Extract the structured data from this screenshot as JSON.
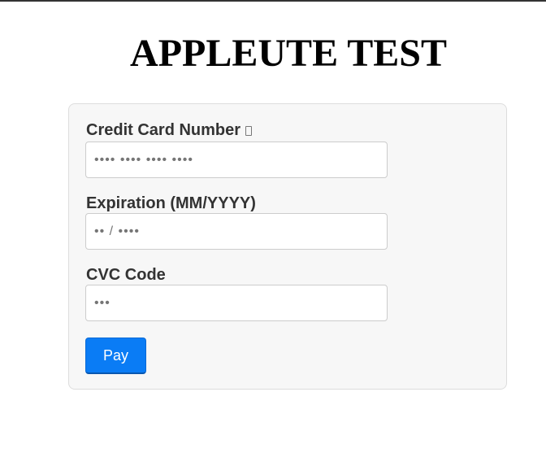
{
  "page": {
    "title": "APPLEUTE TEST"
  },
  "form": {
    "card_number": {
      "label": "Credit Card Number",
      "placeholder": "•••• •••• •••• ••••",
      "value": "",
      "icon": "card-icon"
    },
    "expiration": {
      "label": "Expiration (MM/YYYY)",
      "placeholder": "•• / ••••",
      "value": ""
    },
    "cvc": {
      "label": "CVC Code",
      "placeholder": "•••",
      "value": ""
    },
    "pay_label": "Pay"
  },
  "colors": {
    "accent": "#0a7cf5",
    "card_background": "#f7f7f7",
    "label_text": "#333333"
  }
}
